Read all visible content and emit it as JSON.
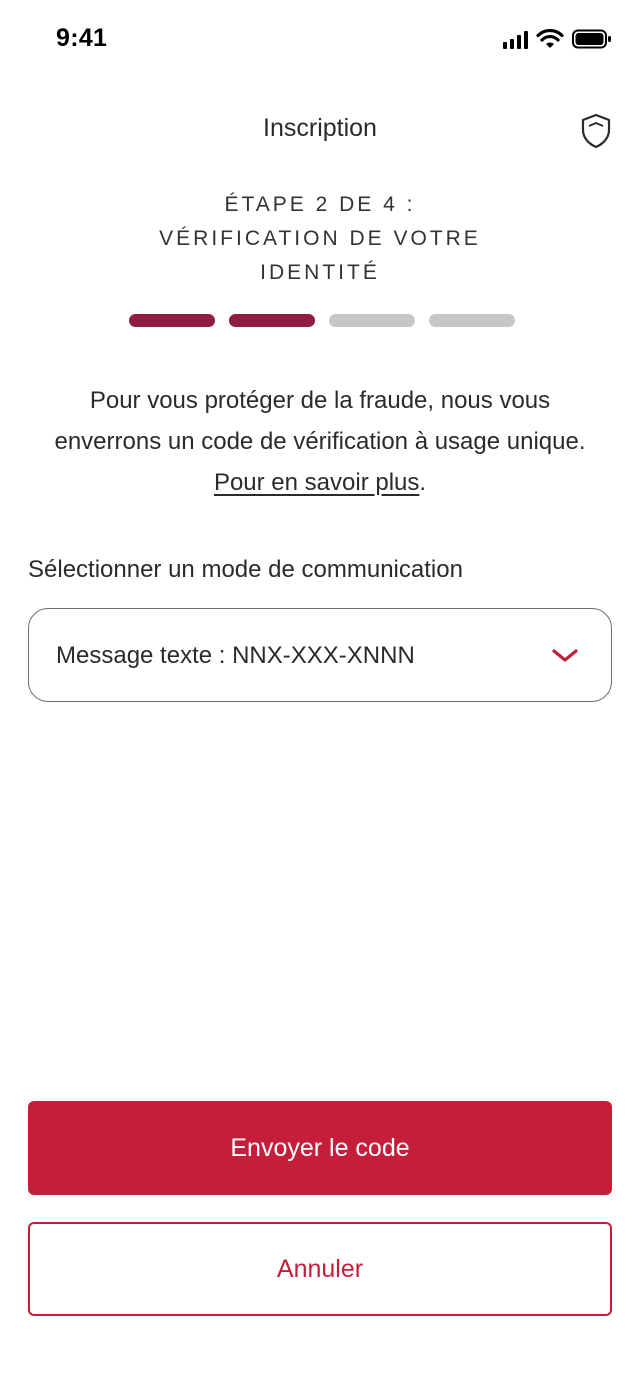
{
  "status_bar": {
    "time": "9:41"
  },
  "header": {
    "title": "Inscription",
    "security_icon": "shield-icon"
  },
  "step": {
    "line1": "ÉTAPE 2 DE 4 :",
    "line2": "VÉRIFICATION DE VOTRE",
    "line3": "IDENTITÉ",
    "current": 2,
    "total": 4
  },
  "intro": {
    "text": "Pour vous protéger de la fraude, nous vous enverrons un code de vérification à usage unique. ",
    "link": "Pour en savoir plus",
    "end": "."
  },
  "contact_select": {
    "label": "Sélectionner un mode de communication",
    "value": "Message texte : NNX-XXX-XNNN",
    "icon": "chevron-down-icon"
  },
  "actions": {
    "send": "Envoyer le code",
    "cancel": "Annuler"
  },
  "colors": {
    "brand": "#c41e3a",
    "progress_done": "#8e1d41",
    "progress_todo": "#c6c6c6"
  }
}
